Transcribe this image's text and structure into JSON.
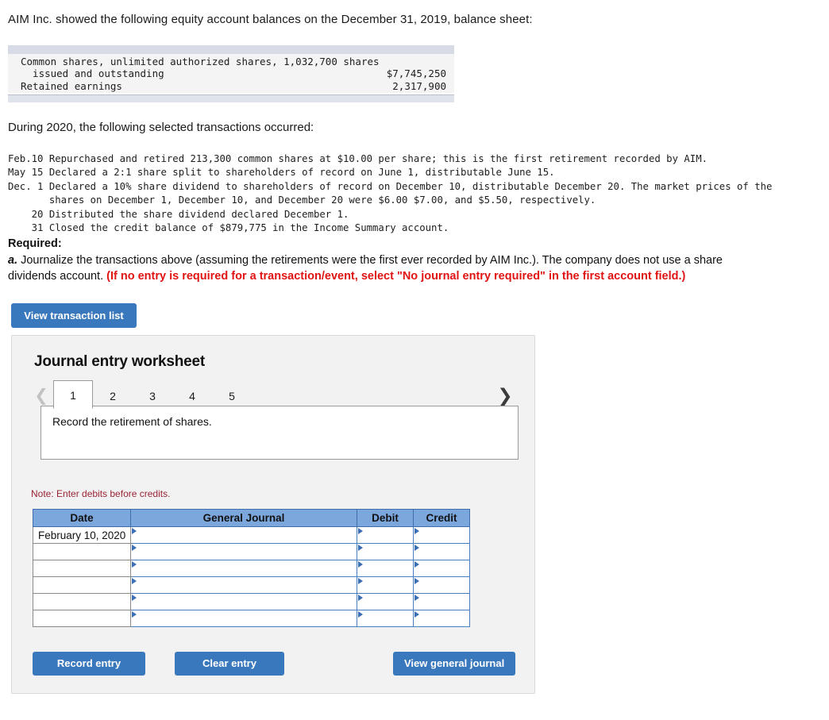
{
  "intro": "AIM Inc. showed the following equity account balances on the December 31, 2019, balance sheet:",
  "balance_sheet": {
    "rows": [
      {
        "label": "Common shares, unlimited authorized shares, 1,032,700 shares",
        "amount": ""
      },
      {
        "label": "  issued and outstanding",
        "amount": "$7,745,250"
      },
      {
        "label": "Retained earnings",
        "amount": "2,317,900"
      }
    ]
  },
  "during_heading": "During 2020, the following selected transactions occurred:",
  "transactions": [
    "Feb.10 Repurchased and retired 213,300 common shares at $10.00 per share; this is the first retirement recorded by AIM.",
    "May 15 Declared a 2:1 share split to shareholders of record on June 1, distributable June 15.",
    "Dec. 1 Declared a 10% share dividend to shareholders of record on December 10, distributable December 20. The market prices of the",
    "       shares on December 1, December 10, and December 20 were $6.00 $7.00, and $5.50, respectively.",
    "    20 Distributed the share dividend declared December 1.",
    "    31 Closed the credit balance of $879,775 in the Income Summary account."
  ],
  "required": {
    "heading": "Required:",
    "letter": "a.",
    "body": " Journalize the transactions above (assuming the retirements were the first ever recorded by AIM Inc.). The company does not use a share dividends account. ",
    "red_note": "(If no entry is required for a transaction/event, select \"No journal entry required\" in the first account field.)"
  },
  "view_transaction_list_label": "View transaction list",
  "worksheet": {
    "title": "Journal entry worksheet",
    "prev_icon": "chevron-left-icon",
    "next_icon": "chevron-right-icon",
    "tabs": [
      "1",
      "2",
      "3",
      "4",
      "5"
    ],
    "active_tab": "1",
    "instruction": "Record the retirement of shares.",
    "note": "Note: Enter debits before credits.",
    "table": {
      "headers": [
        "Date",
        "General Journal",
        "Debit",
        "Credit"
      ],
      "rows": [
        {
          "date": "February 10, 2020",
          "general_journal": "",
          "debit": "",
          "credit": ""
        },
        {
          "date": "",
          "general_journal": "",
          "debit": "",
          "credit": ""
        },
        {
          "date": "",
          "general_journal": "",
          "debit": "",
          "credit": ""
        },
        {
          "date": "",
          "general_journal": "",
          "debit": "",
          "credit": ""
        },
        {
          "date": "",
          "general_journal": "",
          "debit": "",
          "credit": ""
        },
        {
          "date": "",
          "general_journal": "",
          "debit": "",
          "credit": ""
        }
      ]
    },
    "buttons": {
      "record": "Record entry",
      "clear": "Clear entry",
      "view_general_journal": "View general journal"
    }
  },
  "colors": {
    "button_blue": "#3a78bd",
    "table_header_blue": "#7ba7dd",
    "cell_border_blue": "#4a7dbd",
    "red_note": "#e11414",
    "note_maroon": "#9b2335",
    "panel_bg": "#f2f2f2",
    "balance_bar": "#d6dbe6"
  }
}
